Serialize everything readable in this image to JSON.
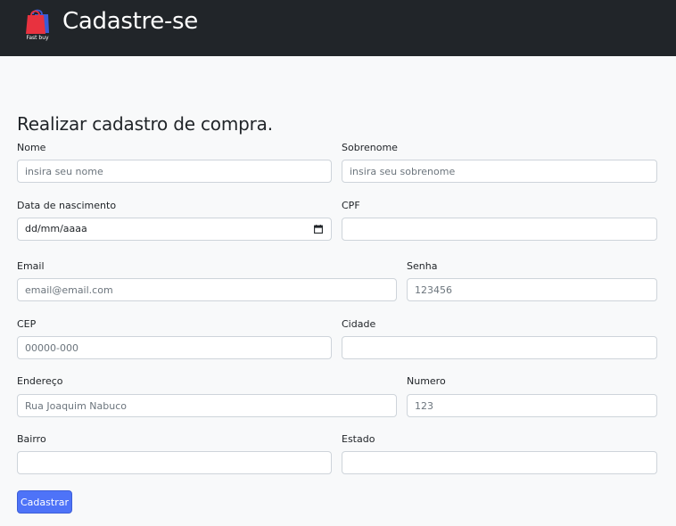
{
  "header": {
    "logo_text": "Fast buy",
    "title": "Cadastre-se"
  },
  "form": {
    "heading": "Realizar cadastro de compra.",
    "nome": {
      "label": "Nome",
      "placeholder": "insira seu nome"
    },
    "sobrenome": {
      "label": "Sobrenome",
      "placeholder": "insira seu sobrenome"
    },
    "nascimento": {
      "label": "Data de nascimento",
      "placeholder": "dd/mm/aaaa"
    },
    "cpf": {
      "label": "CPF",
      "placeholder": ""
    },
    "email": {
      "label": "Email",
      "placeholder": "email@email.com"
    },
    "senha": {
      "label": "Senha",
      "placeholder": "123456"
    },
    "cep": {
      "label": "CEP",
      "placeholder": "00000-000"
    },
    "cidade": {
      "label": "Cidade",
      "placeholder": ""
    },
    "endereco": {
      "label": "Endereço",
      "placeholder": "Rua Joaquim Nabuco"
    },
    "numero": {
      "label": "Numero",
      "placeholder": "123"
    },
    "bairro": {
      "label": "Bairro",
      "placeholder": ""
    },
    "estado": {
      "label": "Estado",
      "placeholder": ""
    },
    "submit_label": "Cadastrar"
  },
  "colors": {
    "navbar": "#212529",
    "page_background": "#f8f9fa",
    "button": "#4e73f8",
    "logo_bag_red": "#e8323f",
    "logo_bag_blue": "#3b5bd6"
  }
}
